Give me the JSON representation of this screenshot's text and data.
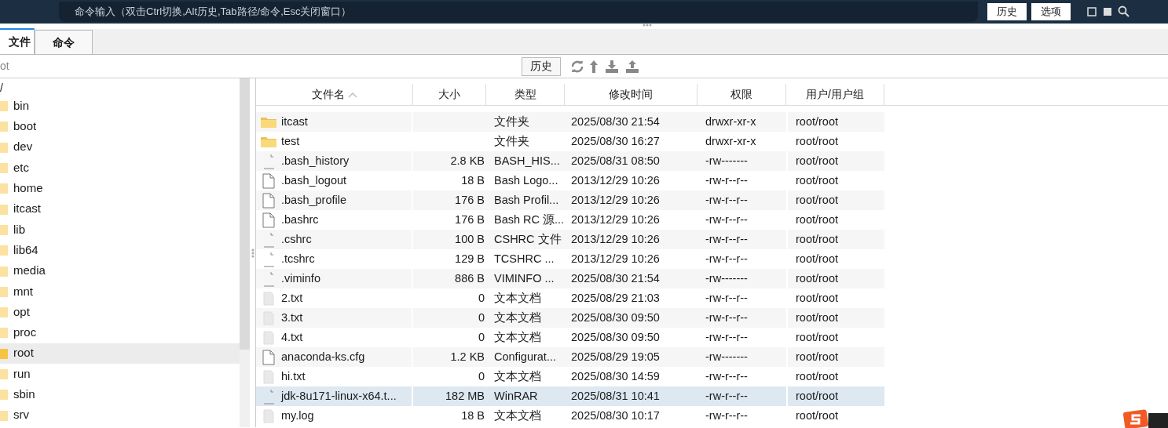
{
  "command_bar": {
    "hint": "命令输入（双击Ctrl切换,Alt历史,Tab路径/命令,Esc关闭窗口）",
    "buttons": [
      "历史",
      "选项"
    ]
  },
  "tabs": [
    {
      "label": "文件",
      "selected": true
    },
    {
      "label": "命令",
      "selected": false
    }
  ],
  "path_bar": {
    "value": "ot",
    "history_button": "历史"
  },
  "tree": {
    "root": "/",
    "children": [
      {
        "label": "bin",
        "selected": false
      },
      {
        "label": "boot",
        "selected": false
      },
      {
        "label": "dev",
        "selected": false
      },
      {
        "label": "etc",
        "selected": false
      },
      {
        "label": "home",
        "selected": false
      },
      {
        "label": "itcast",
        "selected": false
      },
      {
        "label": "lib",
        "selected": false
      },
      {
        "label": "lib64",
        "selected": false
      },
      {
        "label": "media",
        "selected": false
      },
      {
        "label": "mnt",
        "selected": false
      },
      {
        "label": "opt",
        "selected": false
      },
      {
        "label": "proc",
        "selected": false
      },
      {
        "label": "root",
        "selected": true
      },
      {
        "label": "run",
        "selected": false
      },
      {
        "label": "sbin",
        "selected": false
      },
      {
        "label": "srv",
        "selected": false
      }
    ]
  },
  "table": {
    "columns": [
      {
        "label": "文件名",
        "sorted": true
      },
      {
        "label": "大小",
        "sorted": false
      },
      {
        "label": "类型",
        "sorted": false
      },
      {
        "label": "修改时间",
        "sorted": false
      },
      {
        "label": "权限",
        "sorted": false
      },
      {
        "label": "用户/用户组",
        "sorted": false
      }
    ],
    "rows": [
      {
        "kind": "folder",
        "name": "itcast",
        "size": "",
        "type": "文件夹",
        "modified": "2025/08/30 21:54",
        "permissions": "drwxr-xr-x",
        "owner": "root/root",
        "selected": false
      },
      {
        "kind": "folder",
        "name": "test",
        "size": "",
        "type": "文件夹",
        "modified": "2025/08/30 16:27",
        "permissions": "drwxr-xr-x",
        "owner": "root/root",
        "selected": false
      },
      {
        "kind": "unknown",
        "name": ".bash_history",
        "size": "2.8 KB",
        "type": "BASH_HIS...",
        "modified": "2025/08/31 08:50",
        "permissions": "-rw-------",
        "owner": "root/root",
        "selected": false
      },
      {
        "kind": "document",
        "name": ".bash_logout",
        "size": "18 B",
        "type": "Bash Logo...",
        "modified": "2013/12/29 10:26",
        "permissions": "-rw-r--r--",
        "owner": "root/root",
        "selected": false
      },
      {
        "kind": "document",
        "name": ".bash_profile",
        "size": "176 B",
        "type": "Bash Profil...",
        "modified": "2013/12/29 10:26",
        "permissions": "-rw-r--r--",
        "owner": "root/root",
        "selected": false
      },
      {
        "kind": "document",
        "name": ".bashrc",
        "size": "176 B",
        "type": "Bash RC 源...",
        "modified": "2013/12/29 10:26",
        "permissions": "-rw-r--r--",
        "owner": "root/root",
        "selected": false
      },
      {
        "kind": "unknown",
        "name": ".cshrc",
        "size": "100 B",
        "type": "CSHRC 文件",
        "modified": "2013/12/29 10:26",
        "permissions": "-rw-r--r--",
        "owner": "root/root",
        "selected": false
      },
      {
        "kind": "unknown",
        "name": ".tcshrc",
        "size": "129 B",
        "type": "TCSHRC ...",
        "modified": "2013/12/29 10:26",
        "permissions": "-rw-r--r--",
        "owner": "root/root",
        "selected": false
      },
      {
        "kind": "unknown",
        "name": ".viminfo",
        "size": "886 B",
        "type": "VIMINFO ...",
        "modified": "2025/08/30 21:54",
        "permissions": "-rw-------",
        "owner": "root/root",
        "selected": false
      },
      {
        "kind": "text",
        "name": "2.txt",
        "size": "0",
        "type": "文本文档",
        "modified": "2025/08/29 21:03",
        "permissions": "-rw-r--r--",
        "owner": "root/root",
        "selected": false
      },
      {
        "kind": "text",
        "name": "3.txt",
        "size": "0",
        "type": "文本文档",
        "modified": "2025/08/30 09:50",
        "permissions": "-rw-r--r--",
        "owner": "root/root",
        "selected": false
      },
      {
        "kind": "text",
        "name": "4.txt",
        "size": "0",
        "type": "文本文档",
        "modified": "2025/08/30 09:50",
        "permissions": "-rw-r--r--",
        "owner": "root/root",
        "selected": false
      },
      {
        "kind": "document",
        "name": "anaconda-ks.cfg",
        "size": "1.2 KB",
        "type": "Configurat...",
        "modified": "2025/08/29 19:05",
        "permissions": "-rw-------",
        "owner": "root/root",
        "selected": false
      },
      {
        "kind": "text",
        "name": "hi.txt",
        "size": "0",
        "type": "文本文档",
        "modified": "2025/08/30 14:59",
        "permissions": "-rw-r--r--",
        "owner": "root/root",
        "selected": false
      },
      {
        "kind": "unknown",
        "name": "jdk-8u171-linux-x64.t...",
        "size": "182 MB",
        "type": "WinRAR",
        "modified": "2025/08/31 10:41",
        "permissions": "-rw-r--r--",
        "owner": "root/root",
        "selected": true
      },
      {
        "kind": "text",
        "name": "my.log",
        "size": "18 B",
        "type": "文本文档",
        "modified": "2025/08/30 10:17",
        "permissions": "-rw-r--r--",
        "owner": "root/root",
        "selected": false
      }
    ]
  }
}
